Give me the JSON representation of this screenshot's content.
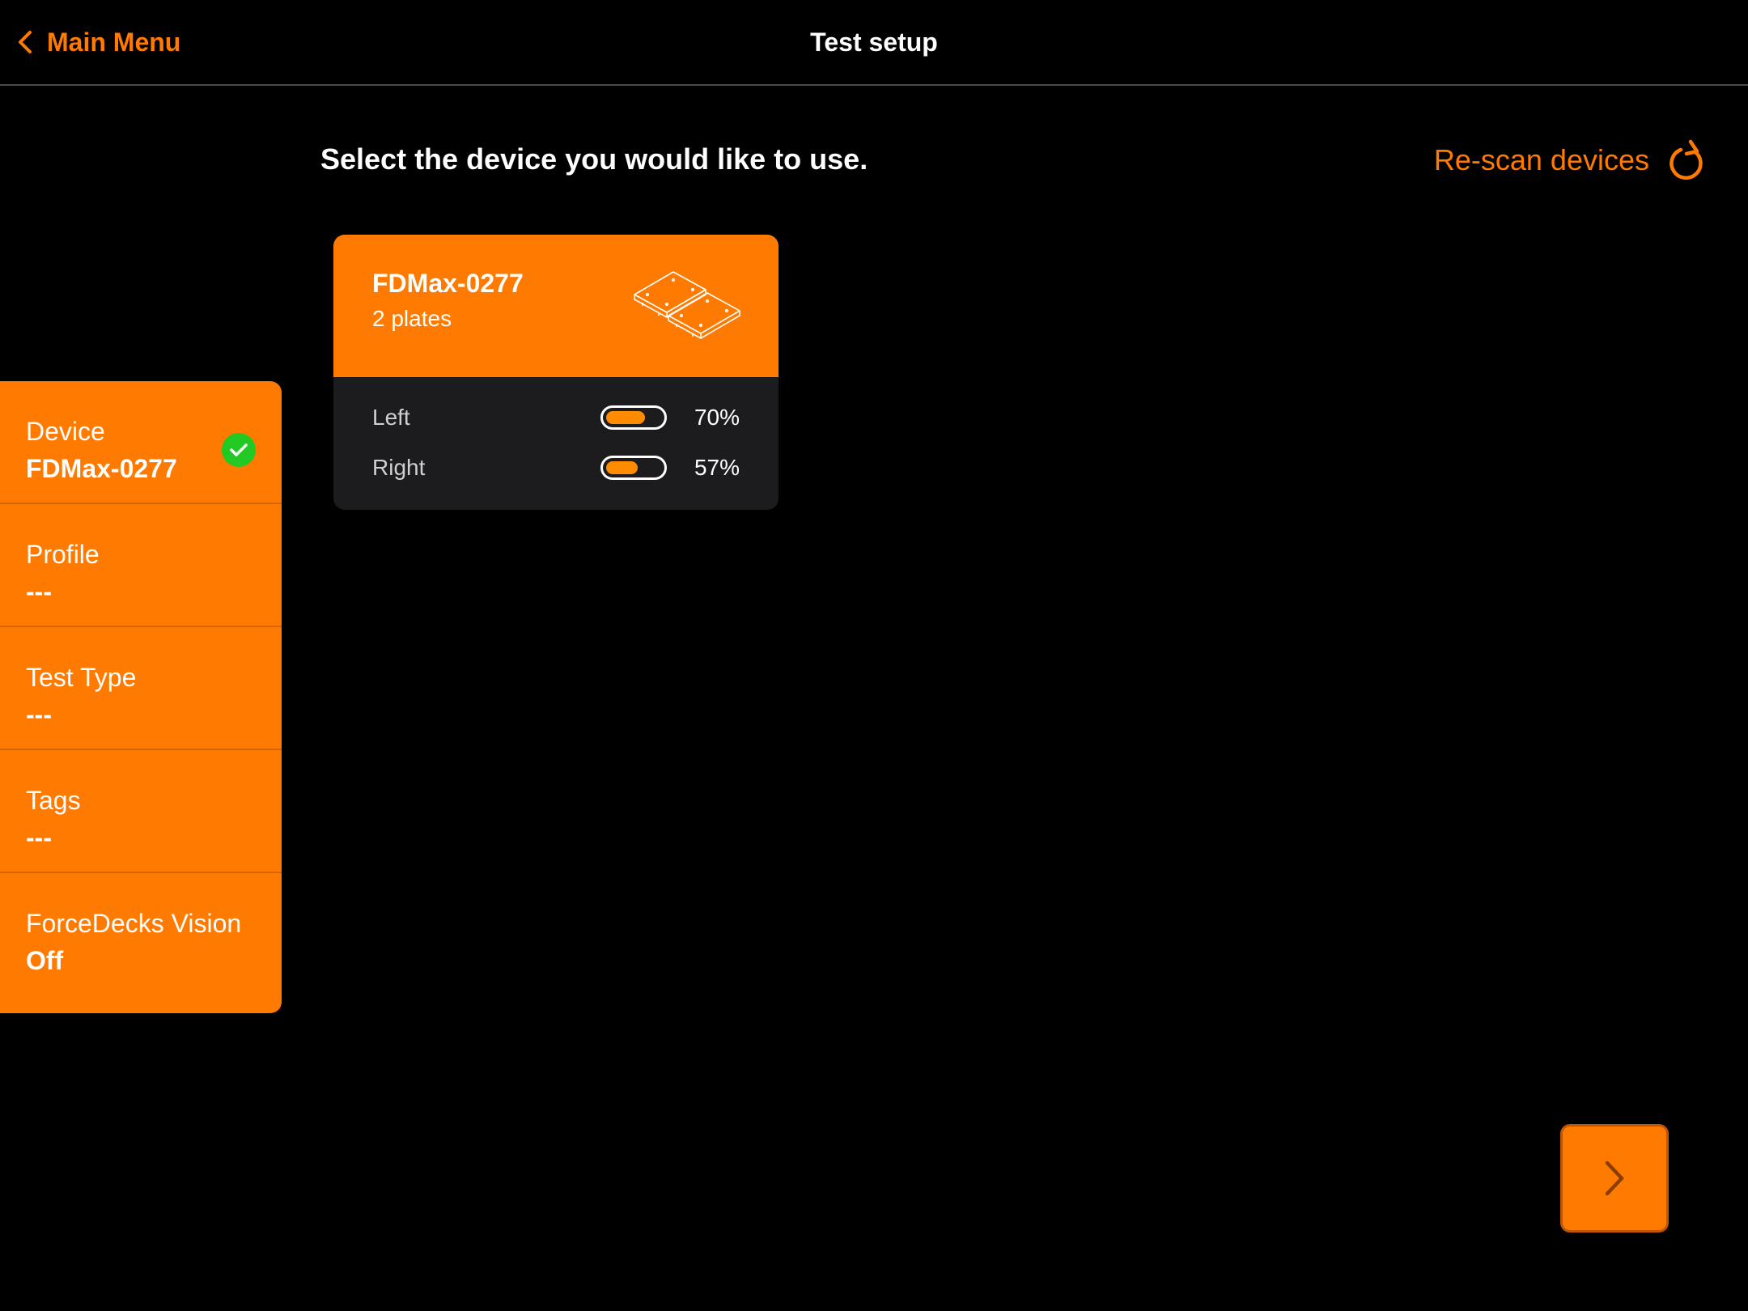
{
  "navbar": {
    "back_label": "Main Menu",
    "title": "Test setup"
  },
  "main": {
    "instruction": "Select the device you would like to use.",
    "rescan_label": "Re-scan devices"
  },
  "device_card": {
    "name": "FDMax-0277",
    "plates": "2 plates",
    "batteries": [
      {
        "label": "Left",
        "percent_text": "70%",
        "level": 0.7
      },
      {
        "label": "Right",
        "percent_text": "57%",
        "level": 0.57
      }
    ]
  },
  "sidebar": {
    "steps": [
      {
        "label": "Device",
        "value": "FDMax-0277",
        "completed": true
      },
      {
        "label": "Profile",
        "value": "---",
        "completed": false
      },
      {
        "label": "Test Type",
        "value": "---",
        "completed": false
      },
      {
        "label": "Tags",
        "value": "---",
        "completed": false
      },
      {
        "label": "ForceDecks Vision",
        "value": "Off",
        "completed": false
      }
    ]
  },
  "icons": {
    "back": "chevron-left-icon",
    "rescan": "refresh-icon",
    "device": "force-plates-icon",
    "check": "checkmark-icon",
    "next": "chevron-right-icon"
  },
  "colors": {
    "accent": "#ff7a00",
    "background": "#000000",
    "card_body": "#1c1c1e",
    "success": "#22c922"
  }
}
